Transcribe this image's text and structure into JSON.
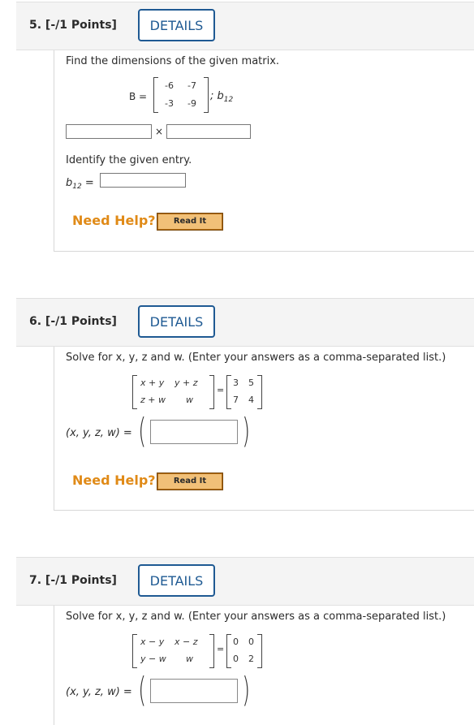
{
  "questions": [
    {
      "number_label": "5. [-/1 Points]",
      "details_label": "DETAILS",
      "prompt": "Find the dimensions of the given matrix.",
      "matrix_name": "B =",
      "matrix": [
        [
          "-6",
          "-7"
        ],
        [
          "-3",
          "-9"
        ]
      ],
      "entry_after": "; b",
      "entry_sub": "12",
      "times_sign": "×",
      "identify_prompt": "Identify the given entry.",
      "entry_label": "b",
      "entry_label_sub": "12",
      "entry_eq": "=",
      "need_help": "Need Help?",
      "read_it": "Read It"
    },
    {
      "number_label": "6. [-/1 Points]",
      "details_label": "DETAILS",
      "prompt": "Solve for x, y, z and w. (Enter your answers as a comma-separated list.)",
      "lhs": [
        [
          "x + y",
          "y + z"
        ],
        [
          "z + w",
          "w"
        ]
      ],
      "equals": "=",
      "rhs": [
        [
          "3",
          "5"
        ],
        [
          "7",
          "4"
        ]
      ],
      "answer_label": "(x, y, z, w) =",
      "need_help": "Need Help?",
      "read_it": "Read It"
    },
    {
      "number_label": "7. [-/1 Points]",
      "details_label": "DETAILS",
      "prompt": "Solve for x, y, z and w. (Enter your answers as a comma-separated list.)",
      "lhs": [
        [
          "x − y",
          "x − z"
        ],
        [
          "y − w",
          "w"
        ]
      ],
      "equals": "=",
      "rhs": [
        [
          "0",
          "0"
        ],
        [
          "0",
          "2"
        ]
      ],
      "answer_label": "(x, y, z, w) ="
    }
  ],
  "colors": {
    "details_border": "#1f5a93",
    "need_help": "#e08a17",
    "read_it_bg": "#f1c078"
  }
}
